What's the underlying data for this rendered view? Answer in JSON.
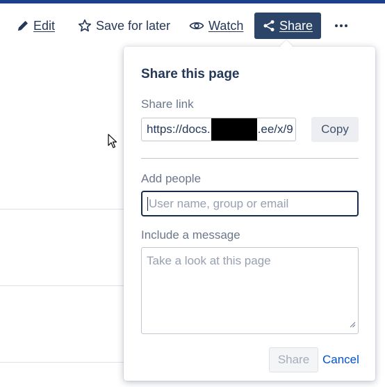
{
  "toolbar": {
    "edit_label": "Edit",
    "save_label": "Save for later",
    "watch_label": "Watch",
    "share_label": "Share",
    "more_icon": "more-horizontal-icon"
  },
  "popup": {
    "title": "Share this page",
    "share_link_label": "Share link",
    "share_link_prefix": "https://docs.",
    "share_link_suffix": ".ee/x/9",
    "copy_label": "Copy",
    "add_people_label": "Add people",
    "add_people_placeholder": "User name, group or email",
    "message_label": "Include a message",
    "message_placeholder": "Take a look at this page",
    "share_button": "Share",
    "cancel_button": "Cancel"
  },
  "colors": {
    "accent": "#1a3f8c",
    "share_button_bg": "#2d4469",
    "link": "#0052cc"
  }
}
